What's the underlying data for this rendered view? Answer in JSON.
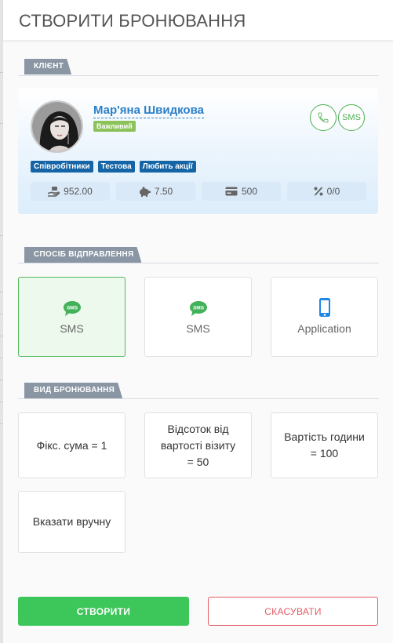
{
  "header": {
    "title": "СТВОРИТИ БРОНЮВАННЯ"
  },
  "client_section": {
    "label": "КЛІЄНТ",
    "client": {
      "name": "Мар'яна Швидкова",
      "badge": "Важливий",
      "sms_label": "SMS",
      "tags": [
        "Співробітники",
        "Тестова",
        "Любить акції"
      ],
      "stats": [
        {
          "icon": "money-hand-icon",
          "value": "952.00"
        },
        {
          "icon": "piggy-bank-icon",
          "value": "7.50"
        },
        {
          "icon": "credit-card-icon",
          "value": "500"
        },
        {
          "icon": "percent-icon",
          "value": "0/0"
        }
      ]
    }
  },
  "send_section": {
    "label": "СПОСІБ ВІДПРАВЛЕННЯ",
    "options": [
      {
        "label": "SMS",
        "icon": "sms-chat-icon",
        "selected": true
      },
      {
        "label": "SMS",
        "icon": "sms-chat-icon",
        "selected": false
      },
      {
        "label": "Application",
        "icon": "smartphone-icon",
        "selected": false
      }
    ]
  },
  "type_section": {
    "label": "ВИД БРОНЮВАННЯ",
    "options": [
      {
        "label": "Фікс. сума = 1"
      },
      {
        "label": "Відсоток від вартості візиту = 50"
      },
      {
        "label": "Вартість години = 100"
      },
      {
        "label": "Вказати вручну"
      }
    ]
  },
  "actions": {
    "create_label": "СТВОРИТИ",
    "cancel_label": "СКАСУВАТИ"
  },
  "colors": {
    "accent_green": "#3dc65a",
    "link_blue": "#2a7fc7",
    "tag_blue": "#1565a6",
    "cancel_red": "#e25b64",
    "icon_blue": "#1e88e5"
  }
}
